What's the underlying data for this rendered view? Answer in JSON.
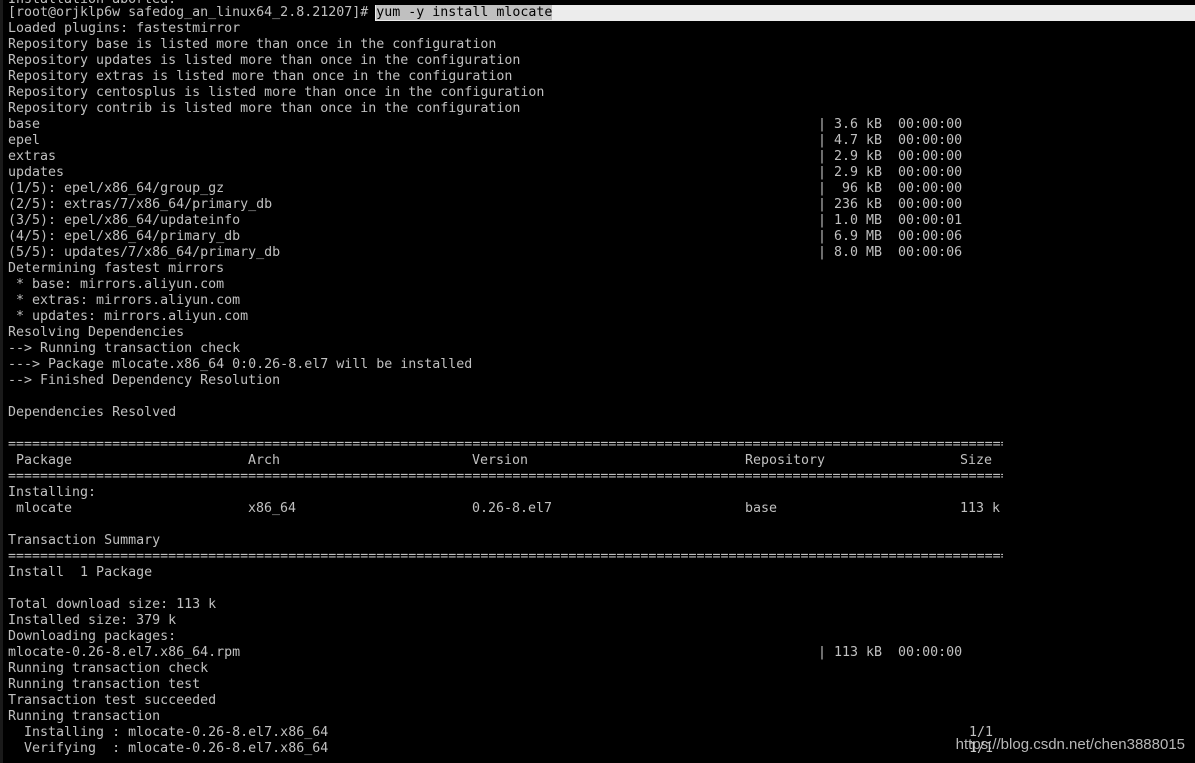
{
  "prompt": "[root@orjklp6w safedog_an_linux64_2.8.21207]# ",
  "command": "yum -y install mlocate",
  "cut_top": "Installation aborted.",
  "log1": [
    "Loaded plugins: fastestmirror",
    "Repository base is listed more than once in the configuration",
    "Repository updates is listed more than once in the configuration",
    "Repository extras is listed more than once in the configuration",
    "Repository centosplus is listed more than once in the configuration",
    "Repository contrib is listed more than once in the configuration"
  ],
  "downloads": [
    {
      "name": "base",
      "size": "| 3.6 kB  00:00:00"
    },
    {
      "name": "epel",
      "size": "| 4.7 kB  00:00:00"
    },
    {
      "name": "extras",
      "size": "| 2.9 kB  00:00:00"
    },
    {
      "name": "updates",
      "size": "| 2.9 kB  00:00:00"
    },
    {
      "name": "(1/5): epel/x86_64/group_gz",
      "size": "|  96 kB  00:00:00"
    },
    {
      "name": "(2/5): extras/7/x86_64/primary_db",
      "size": "| 236 kB  00:00:00"
    },
    {
      "name": "(3/5): epel/x86_64/updateinfo",
      "size": "| 1.0 MB  00:00:01"
    },
    {
      "name": "(4/5): epel/x86_64/primary_db",
      "size": "| 6.9 MB  00:00:06"
    },
    {
      "name": "(5/5): updates/7/x86_64/primary_db",
      "size": "| 8.0 MB  00:00:06"
    }
  ],
  "log2": [
    "Determining fastest mirrors",
    " * base: mirrors.aliyun.com",
    " * extras: mirrors.aliyun.com",
    " * updates: mirrors.aliyun.com",
    "Resolving Dependencies",
    "--> Running transaction check",
    "---> Package mlocate.x86_64 0:0.26-8.el7 will be installed",
    "--> Finished Dependency Resolution",
    "",
    "Dependencies Resolved",
    ""
  ],
  "rule_eq": "========================================================================================================================================",
  "table": {
    "headers": [
      " Package",
      "Arch",
      "Version",
      "Repository",
      "Size"
    ],
    "section": "Installing:",
    "row": [
      " mlocate",
      "x86_64",
      "0.26-8.el7",
      "base",
      "113 k"
    ]
  },
  "summary_title": "Transaction Summary",
  "install_line": "Install  1 Package",
  "log3": [
    "",
    "Total download size: 113 k",
    "Installed size: 379 k",
    "Downloading packages:"
  ],
  "rpm": {
    "name": "mlocate-0.26-8.el7.x86_64.rpm",
    "size": "| 113 kB  00:00:00"
  },
  "log4": [
    "Running transaction check",
    "Running transaction test",
    "Transaction test succeeded",
    "Running transaction"
  ],
  "steps": [
    {
      "text": "  Installing : mlocate-0.26-8.el7.x86_64",
      "count": "1/1"
    },
    {
      "text": "  Verifying  : mlocate-0.26-8.el7.x86_64",
      "count": "1/1"
    }
  ],
  "watermark": "https://blog.csdn.net/chen3888015"
}
